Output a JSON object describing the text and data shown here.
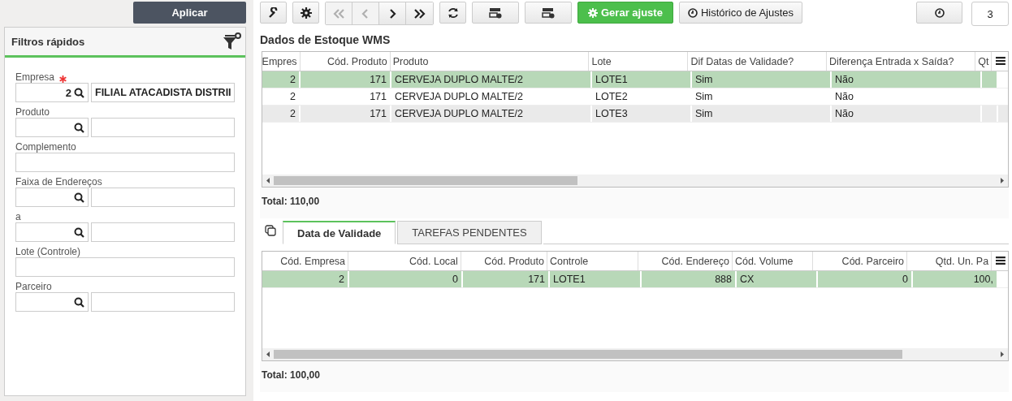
{
  "apply_button": "Aplicar",
  "filters": {
    "title": "Filtros rápidos",
    "fields": [
      {
        "kind": "lookup",
        "label": "Empresa",
        "required": true,
        "code": "2",
        "description": "FILIAL ATACADISTA DISTRII"
      },
      {
        "kind": "lookup",
        "label": "Produto",
        "required": false
      },
      {
        "kind": "text",
        "label": "Complemento",
        "required": false
      },
      {
        "kind": "lookup",
        "label": "Faixa de Endereços",
        "required": false
      },
      {
        "kind": "lookup",
        "label": "a",
        "required": false
      },
      {
        "kind": "text",
        "label": "Lote (Controle)",
        "required": false
      },
      {
        "kind": "lookup",
        "label": "Parceiro",
        "required": false
      }
    ]
  },
  "toolbar": {
    "nav": [
      {
        "kind": "first",
        "disabled": true
      },
      {
        "kind": "prev",
        "disabled": true
      },
      {
        "kind": "next",
        "disabled": false
      },
      {
        "kind": "last",
        "disabled": false
      }
    ],
    "generate_button": "Gerar ajuste",
    "history_button": "Histórico de Ajustes",
    "count_badge": "3"
  },
  "main_grid": {
    "title": "Dados de Estoque WMS",
    "columns": [
      {
        "label": "Empres"
      },
      {
        "label": "Cód. Produto"
      },
      {
        "label": "Produto"
      },
      {
        "label": "Lote"
      },
      {
        "label": "Dif Datas de Validade?"
      },
      {
        "label": "Diferença Entrada x Saída?"
      },
      {
        "label": "Qt"
      }
    ],
    "rows": [
      {
        "selected": true,
        "cells": [
          "2",
          "171",
          "CERVEJA DUPLO MALTE/2",
          "LOTE1",
          "Sim",
          "Não"
        ]
      },
      {
        "selected": false,
        "cells": [
          "2",
          "171",
          "CERVEJA DUPLO MALTE/2",
          "LOTE2",
          "Sim",
          "Não"
        ]
      },
      {
        "selected": false,
        "cells": [
          "2",
          "171",
          "CERVEJA DUPLO MALTE/2",
          "LOTE3",
          "Sim",
          "Não"
        ]
      }
    ],
    "total": "Total: 110,00"
  },
  "tabs": [
    {
      "label": "Data de Validade",
      "selected": true
    },
    {
      "label": "TAREFAS PENDENTES",
      "selected": false
    }
  ],
  "detail_grid": {
    "columns": [
      {
        "label": "Cód. Empresa"
      },
      {
        "label": "Cód. Local"
      },
      {
        "label": "Cód. Produto"
      },
      {
        "label": "Controle"
      },
      {
        "label": "Cód. Endereço"
      },
      {
        "label": "Cód. Volume"
      },
      {
        "label": "Cód. Parceiro"
      },
      {
        "label": "Qtd. Un. Pa"
      }
    ],
    "rows": [
      {
        "selected": true,
        "cells": [
          "2",
          "0",
          "171",
          "LOTE1",
          "888",
          "CX",
          "0",
          "100,"
        ]
      }
    ],
    "total": "Total: 100,00"
  }
}
